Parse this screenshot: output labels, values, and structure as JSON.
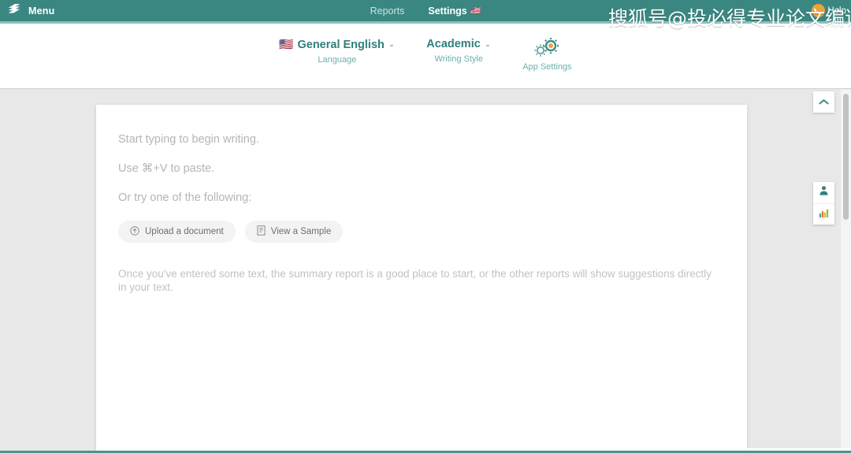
{
  "topbar": {
    "brand_label": "Menu",
    "logo_icon": "stacked-layers-logo",
    "nav": [
      {
        "label": "Reports",
        "active": false,
        "flag": ""
      },
      {
        "label": "Settings",
        "active": true,
        "flag": "🇺🇸"
      }
    ],
    "help_label": "Help",
    "help_icon": "help-circle-icon",
    "accent_active": "#e8a35c",
    "background": "#3a8782"
  },
  "settings_bar": {
    "groups": [
      {
        "value": "General English",
        "label": "Language",
        "flag": "🇺🇸",
        "caret": "⌄",
        "icon": ""
      },
      {
        "value": "Academic",
        "label": "Writing Style",
        "flag": "",
        "caret": "⌄",
        "icon": ""
      },
      {
        "value": "",
        "label": "App Settings",
        "flag": "",
        "caret": "",
        "icon": "gears-icon"
      }
    ],
    "text_color": "#2f7f7a",
    "label_color": "#6bb0ab"
  },
  "editor": {
    "lines": [
      "Start typing to begin writing.",
      "Use ⌘+V to paste.",
      "Or try one of the following:"
    ],
    "buttons": [
      {
        "label": "Upload a document",
        "icon": "upload-circle-icon"
      },
      {
        "label": "View a Sample",
        "icon": "document-icon"
      }
    ],
    "note": "Once you've entered some text, the summary report is a good place to start, or the other reports will show suggestions directly in your text."
  },
  "right_rail": {
    "collapse_icon": "chevron-up-icon",
    "buttons": [
      {
        "icon": "person-icon"
      },
      {
        "icon": "bar-chart-icon"
      }
    ]
  },
  "scrollbar": {
    "orientation": "vertical",
    "thumb_color": "#c2c2c2"
  },
  "watermark": {
    "text": "搜狐号@投必得专业论文编译"
  }
}
